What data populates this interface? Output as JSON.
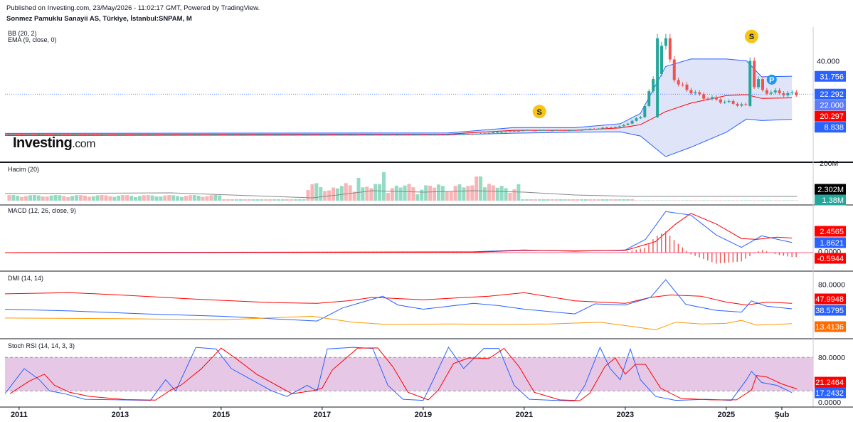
{
  "header": {
    "published": "Published on Investing.com, 23/May/2026 - 11:02:17 GMT, Powered by TradingView.",
    "instrument": "Sonmez Pamuklu Sanayii AS, Türkiye, İstanbul:SNPAM, M"
  },
  "logo": {
    "main": "Investing",
    "suffix": ".com"
  },
  "colors": {
    "up": "#26a69a",
    "down": "#ef5350",
    "blue": "#2962ff",
    "red": "#ff0000",
    "bbFill": "#d6dbf5",
    "stochBand": "#e6c8e6",
    "volUp": "#94dbc4",
    "volDown": "#f7b5b5"
  },
  "chart_data": [
    {
      "type": "candlestick",
      "title": "Sonmez Pamuklu Sanayii AS, Türkiye, İstanbul:SNPAM, M",
      "indicators": [
        "BB (20, 2)",
        "EMA (9, close, 0)"
      ],
      "x_ticks": [
        "2011",
        "2013",
        "2015",
        "2017",
        "2019",
        "2021",
        "2023",
        "2025",
        "Şub"
      ],
      "y_ticks": [
        "40.000"
      ],
      "ylim": [
        -14,
        58
      ],
      "price_tags": [
        {
          "text": "31.756",
          "value": 31.756,
          "color": "#2962ff"
        },
        {
          "text": "22.292",
          "value": 22.292,
          "color": "#2962ff"
        },
        {
          "text": "22.000",
          "value": 22.0,
          "color": "#5c7cfa"
        },
        {
          "text": "20.297",
          "value": 20.297,
          "color": "#ff0000"
        },
        {
          "text": "8.838",
          "value": 8.838,
          "color": "#2962ff"
        }
      ],
      "markers": [
        {
          "label": "S",
          "date": 2021.3,
          "value": 13
        },
        {
          "label": "S",
          "date": 2025.5,
          "value": 53
        },
        {
          "label": "P",
          "date": 2025.9,
          "value": 30
        }
      ],
      "last_price_line": 22.292,
      "candles_approx": [
        {
          "t": 2010.8,
          "c": 0.8
        },
        {
          "t": 2015,
          "c": 0.9
        },
        {
          "t": 2018,
          "c": 1.0
        },
        {
          "t": 2020,
          "c": 1.0
        },
        {
          "t": 2021,
          "c": 3.0
        },
        {
          "t": 2022,
          "c": 3.0
        },
        {
          "t": 2022.9,
          "c": 5.0
        },
        {
          "t": 2023.3,
          "c": 10.0
        },
        {
          "t": 2023.6,
          "c": 33
        },
        {
          "t": 2023.8,
          "c": 50
        },
        {
          "t": 2024,
          "c": 28
        },
        {
          "t": 2024.5,
          "c": 21
        },
        {
          "t": 2025,
          "c": 18
        },
        {
          "t": 2025.4,
          "c": 16
        },
        {
          "t": 2025.5,
          "c": 40
        },
        {
          "t": 2025.7,
          "c": 24
        },
        {
          "t": 2026,
          "c": 23
        },
        {
          "t": 2026.3,
          "c": 22.3
        }
      ]
    },
    {
      "type": "bar",
      "title": "Hacim (20)",
      "y_ticks": [
        "200M"
      ],
      "tags": [
        {
          "text": "2.302M",
          "color": "#000000"
        },
        {
          "text": "1.38M",
          "color": "#26a69a"
        }
      ]
    },
    {
      "type": "line",
      "title": "MACD (12, 26, close, 9)",
      "tags": [
        {
          "text": "2.4565",
          "value": 2.4565,
          "color": "#ff0000"
        },
        {
          "text": "1.8621",
          "value": 1.8621,
          "color": "#2962ff"
        },
        {
          "text": "0.0000",
          "value": 0,
          "color": "#131722"
        },
        {
          "text": "-0.5944",
          "value": -0.5944,
          "color": "#ff0000"
        }
      ]
    },
    {
      "type": "line",
      "title": "DMI (14, 14)",
      "y_ticks": [
        "80.0000"
      ],
      "tags": [
        {
          "text": "47.9948",
          "value": 47.9948,
          "color": "#ff0000"
        },
        {
          "text": "38.5795",
          "value": 38.5795,
          "color": "#2962ff"
        },
        {
          "text": "13.4136",
          "value": 13.4136,
          "color": "#ff6d00"
        }
      ]
    },
    {
      "type": "line",
      "title": "Stoch RSI (14, 14, 3, 3)",
      "y_ticks": [
        "80.0000",
        "0.0000"
      ],
      "bands": [
        20,
        80
      ],
      "tags": [
        {
          "text": "21.2464",
          "value": 21.2464,
          "color": "#ff0000"
        },
        {
          "text": "17.2432",
          "value": 17.2432,
          "color": "#2962ff"
        }
      ]
    }
  ]
}
